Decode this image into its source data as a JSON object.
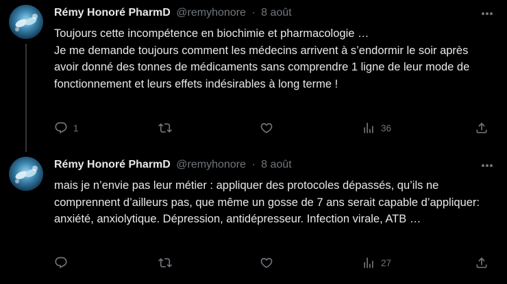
{
  "tweets": [
    {
      "author_name": "Rémy Honoré PharmD",
      "handle": "@remyhonore",
      "separator": "·",
      "date": "8 août",
      "text_lines": [
        "Toujours cette incompétence en biochimie et pharmacologie …",
        "Je me demande toujours comment les médecins arrivent à s’endormir le soir après avoir donné des tonnes de médicaments sans comprendre 1 ligne de leur mode de fonctionnement et leurs effets indésirables à long terme !"
      ],
      "replies": "1",
      "retweets": "",
      "likes": "",
      "views": "36"
    },
    {
      "author_name": "Rémy Honoré PharmD",
      "handle": "@remyhonore",
      "separator": "·",
      "date": "8 août",
      "text_lines": [
        "mais je n’envie pas leur métier : appliquer des protocoles dépassés, qu’ils ne comprennent d’ailleurs pas, que même un gosse de 7 ans serait capable d’appliquer: anxiété, anxiolytique. Dépression, antidépresseur. Infection virale, ATB …"
      ],
      "replies": "",
      "retweets": "",
      "likes": "",
      "views": "27"
    }
  ],
  "icons": {
    "avatar": "avatar-image",
    "more": "more-icon",
    "reply": "reply-icon",
    "retweet": "retweet-icon",
    "like": "heart-icon",
    "views": "views-icon",
    "share": "share-icon"
  },
  "colors": {
    "background": "#000000",
    "text": "#e7e9ea",
    "secondary": "#71767b",
    "thread_line": "#333639"
  }
}
